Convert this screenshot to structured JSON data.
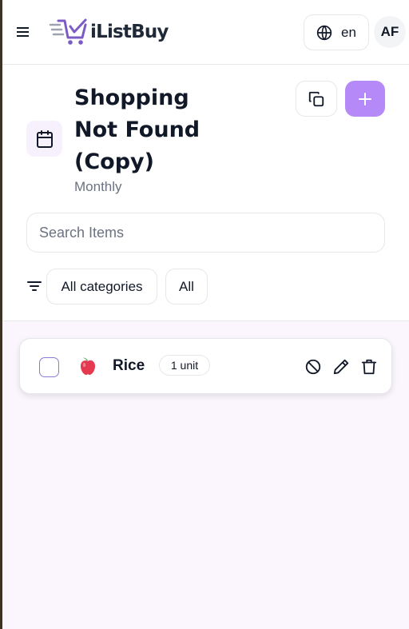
{
  "header": {
    "logo_text": "iListBuy",
    "language": "en",
    "avatar_initials": "AF"
  },
  "list": {
    "title": "Shopping Not Found (Copy)",
    "frequency": "Monthly"
  },
  "search": {
    "placeholder": "Search Items",
    "value": ""
  },
  "filters": {
    "category_label": "All categories",
    "status_label": "All"
  },
  "items": [
    {
      "name": "Rice",
      "quantity": "1 unit",
      "icon": "apple-emoji"
    }
  ],
  "colors": {
    "accent": "#b589f8",
    "list_background": "#fbf6fe",
    "calendar_background": "#f7f1fd",
    "checkbox_border": "#8b7bd8",
    "logo_purple": "#7c5cc4"
  },
  "icons": {
    "menu": "hamburger-icon",
    "language": "globe-icon",
    "calendar": "calendar-icon",
    "copy": "copy-icon",
    "add": "plus-icon",
    "filter": "filter-icon",
    "ban": "ban-icon",
    "edit": "pencil-icon",
    "delete": "trash-icon"
  }
}
